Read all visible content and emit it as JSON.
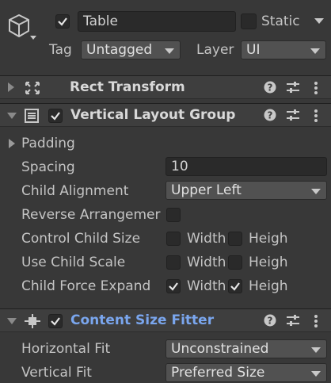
{
  "gameobject": {
    "active": true,
    "name": "Table",
    "static_label": "Static",
    "static_checked": false,
    "tag_label": "Tag",
    "tag_value": "Untagged",
    "layer_label": "Layer",
    "layer_value": "UI"
  },
  "components": {
    "rect_transform": {
      "title": "Rect Transform",
      "expanded": false
    },
    "vertical_layout_group": {
      "title": "Vertical Layout Group",
      "enabled": true,
      "expanded": true,
      "padding_label": "Padding",
      "spacing_label": "Spacing",
      "spacing_value": "10",
      "child_alignment_label": "Child Alignment",
      "child_alignment_value": "Upper Left",
      "reverse_label": "Reverse Arrangemer",
      "reverse_checked": false,
      "control_child_size_label": "Control Child Size",
      "use_child_scale_label": "Use Child Scale",
      "child_force_expand_label": "Child Force Expand",
      "width_label": "Width",
      "height_label": "Heigh",
      "control_child_size": {
        "width": false,
        "height": false
      },
      "use_child_scale": {
        "width": false,
        "height": false
      },
      "child_force_expand": {
        "width": true,
        "height": true
      }
    },
    "content_size_fitter": {
      "title": "Content Size Fitter",
      "enabled": true,
      "expanded": true,
      "horizontal_fit_label": "Horizontal Fit",
      "horizontal_fit_value": "Unconstrained",
      "vertical_fit_label": "Vertical Fit",
      "vertical_fit_value": "Preferred Size"
    }
  },
  "icons": {
    "gameobject": "cube-icon",
    "rect_transform": "rect-transform-icon",
    "layout": "vertical-layout-icon",
    "fitter": "content-size-fitter-icon",
    "help": "help-icon",
    "presets": "presets-icon",
    "menu": "kebab-menu-icon"
  },
  "colors": {
    "background": "#383838",
    "header": "#3e3e3e",
    "field": "#2a2a2a",
    "dropdown": "#515151",
    "link_title": "#7aa6ee"
  }
}
